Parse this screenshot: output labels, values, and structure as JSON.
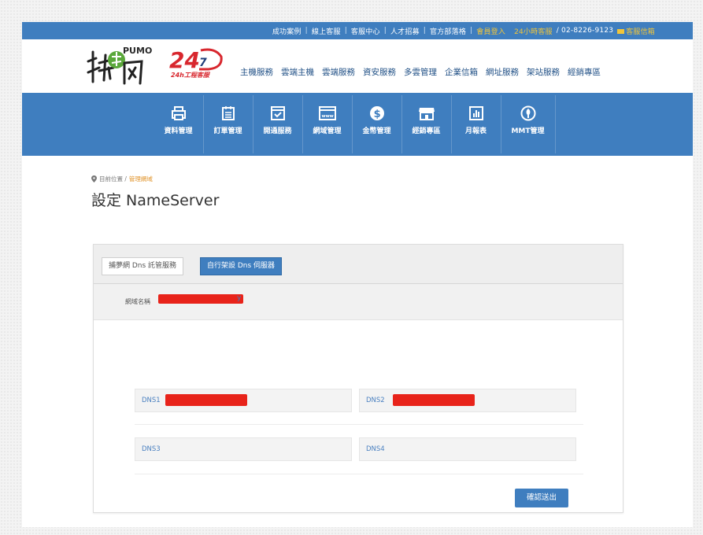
{
  "topbar": {
    "links": [
      "成功案例",
      "線上客服",
      "客服中心",
      "人才招募",
      "官方部落格"
    ],
    "member_login": "會員登入",
    "hotline": "24小時客服",
    "phone": "/ 02-8226-9123",
    "mailbox": "客服信箱"
  },
  "header": {
    "logo_text": "PUMO",
    "badge_sub": "24h工程客服",
    "nav": [
      "主機服務",
      "雲端主機",
      "雲端服務",
      "資安服務",
      "多雲管理",
      "企業信箱",
      "網址服務",
      "架站服務",
      "經銷專區"
    ]
  },
  "admin_menu": [
    {
      "label": "資料管理",
      "icon": "printer-icon"
    },
    {
      "label": "訂單管理",
      "icon": "calendar-list-icon"
    },
    {
      "label": "開通服務",
      "icon": "checkbox-window-icon"
    },
    {
      "label": "網域管理",
      "icon": "www-window-icon"
    },
    {
      "label": "金幣管理",
      "icon": "dollar-coin-icon"
    },
    {
      "label": "經銷專區",
      "icon": "store-icon"
    },
    {
      "label": "月報表",
      "icon": "bar-chart-icon"
    },
    {
      "label": "MMT管理",
      "icon": "mmt-logo-icon"
    }
  ],
  "breadcrumb": {
    "prefix": "目前位置 /",
    "current": "管理網域"
  },
  "page_title": "設定 NameServer",
  "tabs": {
    "hosted": "捕夢網 Dns 託管服務",
    "custom": "自行架設 Dns 伺服器"
  },
  "domain": {
    "label": "網域名稱",
    "tail": "y"
  },
  "dns": {
    "dns1": "DNS1",
    "dns2": "DNS2",
    "dns3": "DNS3",
    "dns4": "DNS4"
  },
  "submit_label": "確認送出",
  "colors": {
    "primary": "#3f7ebf",
    "accent": "#f1c53a",
    "redaction": "#e8231a",
    "breadcrumb_current": "#e0932a"
  }
}
